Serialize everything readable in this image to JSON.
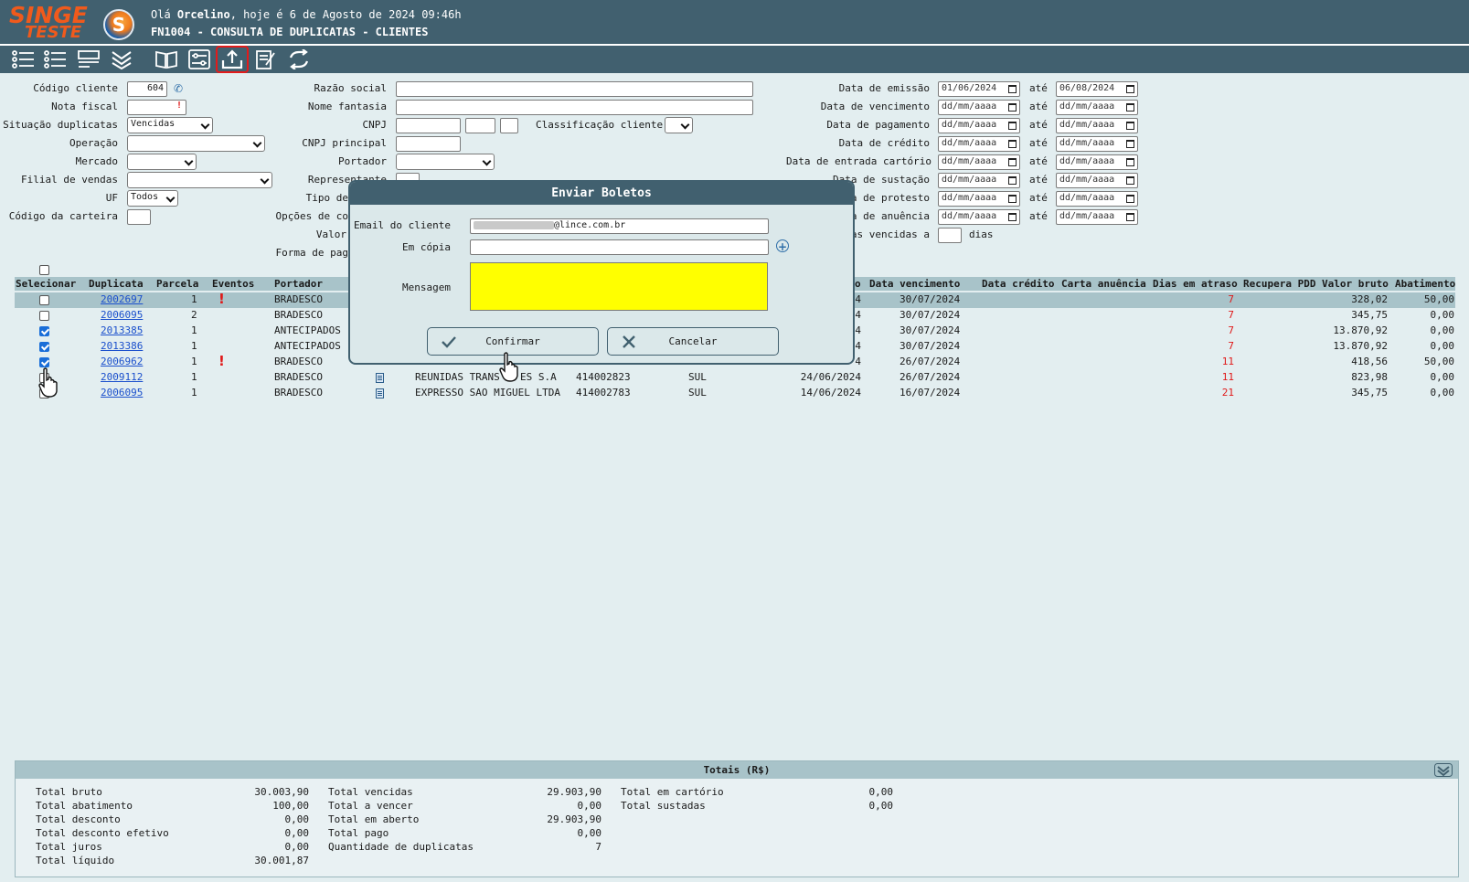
{
  "header": {
    "logo_line1": "SINGE",
    "logo_line2": "TESTE",
    "logo_mark": "S",
    "greeting_prefix": "Olá ",
    "user_name": "Orcelino",
    "greeting_suffix": ", hoje é 6 de Agosto de 2024 09:46h",
    "screen_title": "FN1004 - CONSULTA DE DUPLICATAS - CLIENTES"
  },
  "toolbar": {
    "icons": [
      "list-icon",
      "checklist-icon",
      "report-icon",
      "expand-down-icon",
      "book-icon",
      "filter-settings-icon",
      "upload-icon",
      "edit-document-icon",
      "refresh-icon"
    ],
    "active_icon": "upload-icon"
  },
  "form": {
    "codigo_cliente_label": "Código cliente",
    "codigo_cliente_value": "604",
    "nota_fiscal_label": "Nota fiscal",
    "situacao_label": "Situação duplicatas",
    "situacao_value": "Vencidas",
    "operacao_label": "Operação",
    "mercado_label": "Mercado",
    "filial_label": "Filial de vendas",
    "uf_label": "UF",
    "uf_value": "Todos",
    "codigo_carteira_label": "Código da carteira",
    "razao_social_label": "Razão social",
    "nome_fantasia_label": "Nome fantasia",
    "cnpj_label": "CNPJ",
    "classificacao_label": "Classificação cliente",
    "cnpj_principal_label": "CNPJ principal",
    "portador_label": "Portador",
    "representante_label": "Representante",
    "tipo_label": "Tipo de",
    "opcoes_label": "Opções de co",
    "valor_label": "Valor",
    "forma_label": "Forma de pag",
    "ate_label": "até",
    "dates": [
      {
        "label": "Data de emissão",
        "from": "01/06/2024",
        "to": "06/08/2024"
      },
      {
        "label": "Data de vencimento",
        "from": "dd/mm/aaaa",
        "to": "dd/mm/aaaa"
      },
      {
        "label": "Data de pagamento",
        "from": "dd/mm/aaaa",
        "to": "dd/mm/aaaa"
      },
      {
        "label": "Data de crédito",
        "from": "dd/mm/aaaa",
        "to": "dd/mm/aaaa"
      },
      {
        "label": "Data de entrada cartório",
        "from": "dd/mm/aaaa",
        "to": "dd/mm/aaaa"
      },
      {
        "label": "Data de sustação",
        "from": "dd/mm/aaaa",
        "to": "dd/mm/aaaa"
      },
      {
        "label": "Data de protesto",
        "from": "dd/mm/aaaa",
        "to": "dd/mm/aaaa"
      },
      {
        "label": "Data de anuência",
        "from": "dd/mm/aaaa",
        "to": "dd/mm/aaaa"
      }
    ],
    "vencidas_label": "as vencidas a",
    "dias_label": "dias"
  },
  "table": {
    "headers": [
      "Selecionar",
      "Duplicata",
      "Parcela",
      "Eventos",
      "Portador",
      "o",
      "Data vencimento",
      "Data crédito",
      "Carta anuência",
      "Dias em atraso",
      "Recupera PDD",
      "Valor bruto",
      "Abatimento"
    ],
    "rows": [
      {
        "checked": false,
        "duplicata": "2002697",
        "parcela": "1",
        "evento": true,
        "portador": "BRADESCO",
        "doc": false,
        "cliente": "",
        "cnpj": "",
        "regiao": "",
        "emissao": "4",
        "vencimento": "30/07/2024",
        "dias": "7",
        "valor": "328,02",
        "abatimento": "50,00"
      },
      {
        "checked": false,
        "duplicata": "2006095",
        "parcela": "2",
        "evento": false,
        "portador": "BRADESCO",
        "doc": false,
        "cliente": "",
        "cnpj": "",
        "regiao": "",
        "emissao": "4",
        "vencimento": "30/07/2024",
        "dias": "7",
        "valor": "345,75",
        "abatimento": "0,00"
      },
      {
        "checked": true,
        "duplicata": "2013385",
        "parcela": "1",
        "evento": false,
        "portador": "ANTECIPADOS",
        "doc": false,
        "cliente": "",
        "cnpj": "",
        "regiao": "",
        "emissao": "4",
        "vencimento": "30/07/2024",
        "dias": "7",
        "valor": "13.870,92",
        "abatimento": "0,00"
      },
      {
        "checked": true,
        "duplicata": "2013386",
        "parcela": "1",
        "evento": false,
        "portador": "ANTECIPADOS",
        "doc": false,
        "cliente": "",
        "cnpj": "",
        "regiao": "",
        "emissao": "4",
        "vencimento": "30/07/2024",
        "dias": "7",
        "valor": "13.870,92",
        "abatimento": "0,00"
      },
      {
        "checked": true,
        "duplicata": "2006962",
        "parcela": "1",
        "evento": true,
        "portador": "BRADESCO",
        "doc": false,
        "cliente": "",
        "cnpj": "",
        "regiao": "",
        "emissao": "4",
        "vencimento": "26/07/2024",
        "dias": "11",
        "valor": "418,56",
        "abatimento": "50,00"
      },
      {
        "checked": false,
        "duplicata": "2009112",
        "parcela": "1",
        "evento": false,
        "portador": "BRADESCO",
        "doc": true,
        "cliente": "REUNIDAS TRANS",
        "cliente_tail": "ES S.A",
        "cnpj": "414002823",
        "regiao": "SUL",
        "emissao": "24/06/2024",
        "vencimento": "26/07/2024",
        "dias": "11",
        "valor": "823,98",
        "abatimento": "0,00"
      },
      {
        "checked": false,
        "duplicata": "2006095",
        "parcela": "1",
        "evento": false,
        "portador": "BRADESCO",
        "doc": true,
        "cliente": "EXPRESSO SAO MIGUEL LTDA",
        "cliente_tail": "",
        "cnpj": "414002783",
        "regiao": "SUL",
        "emissao": "14/06/2024",
        "vencimento": "16/07/2024",
        "dias": "21",
        "valor": "345,75",
        "abatimento": "0,00"
      }
    ]
  },
  "modal": {
    "title": "Enviar Boletos",
    "email_label": "Email do cliente",
    "email_value": "@lince.com.br",
    "copia_label": "Em cópia",
    "mensagem_label": "Mensagem",
    "confirm_label": "Confirmar",
    "cancel_label": "Cancelar",
    "message_bg": "#ffff00"
  },
  "totals": {
    "title": "Totais (R$)",
    "col1": [
      {
        "label": "Total bruto",
        "value": "30.003,90"
      },
      {
        "label": "Total abatimento",
        "value": "100,00"
      },
      {
        "label": "Total desconto",
        "value": "0,00"
      },
      {
        "label": "Total desconto efetivo",
        "value": "0,00"
      },
      {
        "label": "Total juros",
        "value": "0,00"
      },
      {
        "label": "Total líquido",
        "value": "30.001,87"
      }
    ],
    "col2": [
      {
        "label": "Total vencidas",
        "value": "29.903,90"
      },
      {
        "label": "Total a vencer",
        "value": "0,00"
      },
      {
        "label": "Total em aberto",
        "value": "29.903,90"
      },
      {
        "label": "Total pago",
        "value": "0,00"
      },
      {
        "label": "Quantidade de duplicatas",
        "value": "7"
      }
    ],
    "col3": [
      {
        "label": "Total em cartório",
        "value": "0,00"
      },
      {
        "label": "Total sustadas",
        "value": "0,00"
      }
    ]
  },
  "colors": {
    "header_bg": "#41606f",
    "page_bg": "#e3eef0",
    "accent_orange": "#f05a1c",
    "link": "#1a4fcc",
    "alert_red": "#e01818"
  }
}
